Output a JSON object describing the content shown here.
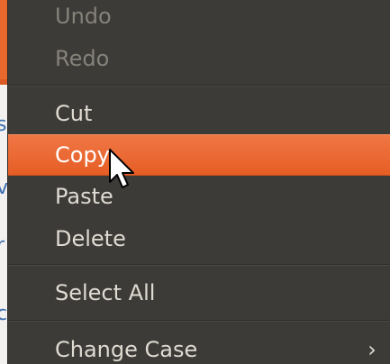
{
  "menu": {
    "items": [
      {
        "label": "Undo",
        "state": "disabled"
      },
      {
        "label": "Redo",
        "state": "disabled"
      },
      {
        "label": "Cut",
        "state": "enabled"
      },
      {
        "label": "Copy",
        "state": "highlighted"
      },
      {
        "label": "Paste",
        "state": "enabled"
      },
      {
        "label": "Delete",
        "state": "enabled"
      },
      {
        "label": "Select All",
        "state": "enabled"
      },
      {
        "label": "Change Case",
        "state": "enabled",
        "submenu_arrow": "›"
      }
    ]
  },
  "colors": {
    "menu_bg": "#3c3b37",
    "menu_text": "#dfdbd2",
    "disabled_text": "#85827a",
    "highlight": "#e9692c"
  },
  "icons": {
    "cursor": "mouse-pointer-icon",
    "submenu": "chevron-right-icon"
  }
}
